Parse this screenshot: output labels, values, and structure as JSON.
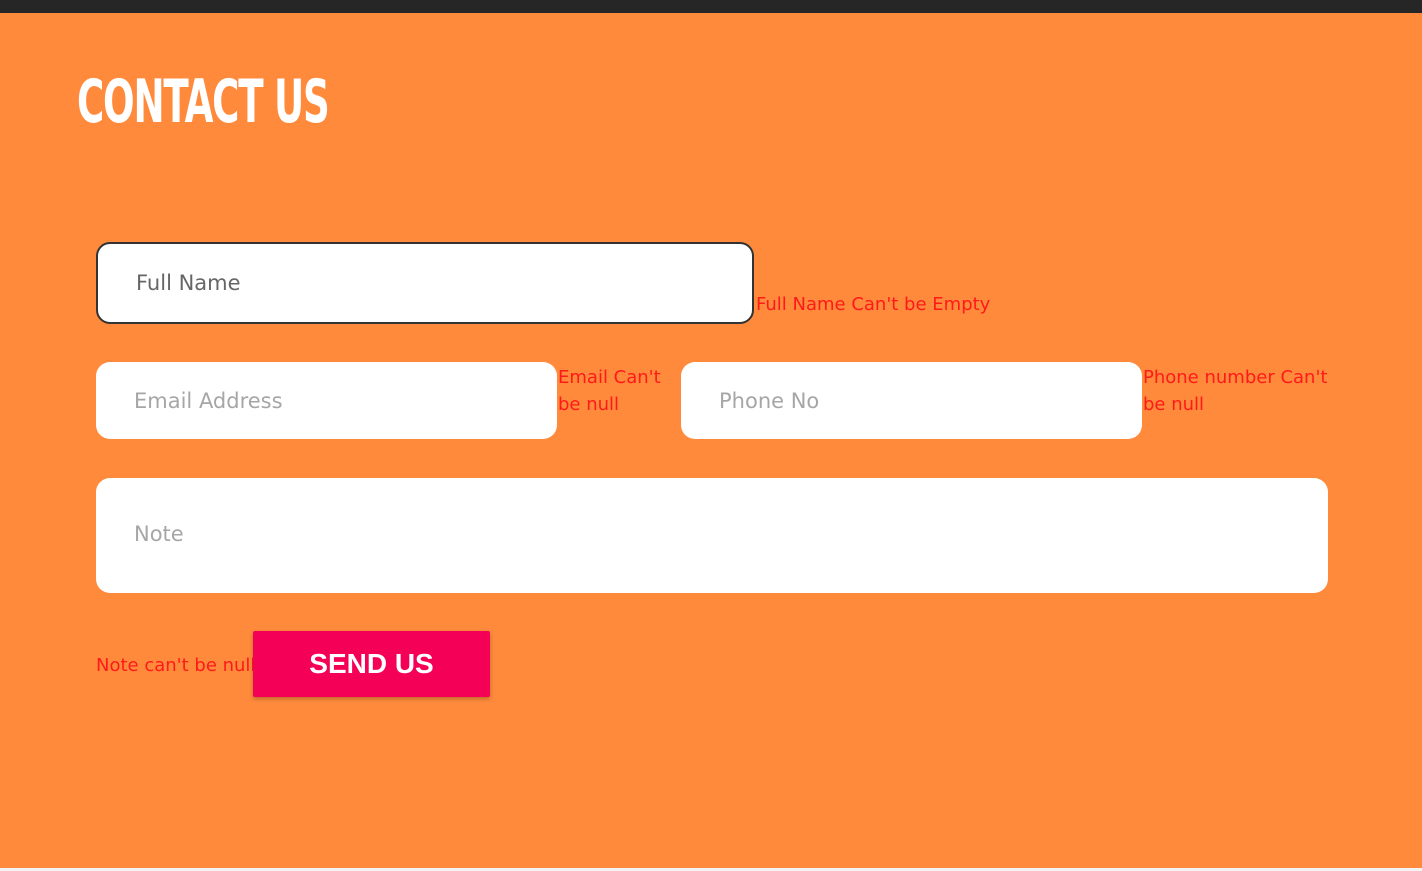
{
  "page": {
    "title": "Contact Us"
  },
  "form": {
    "full_name": {
      "placeholder": "Full Name",
      "error": "Full Name Can't be Empty"
    },
    "email": {
      "placeholder": "Email Address",
      "error": "Email Can't be null"
    },
    "phone": {
      "placeholder": "Phone No",
      "error": "Phone number Can't be null"
    },
    "note": {
      "placeholder": "Note",
      "error": "Note can't be null"
    },
    "submit_label": "SEND US"
  },
  "colors": {
    "background": "#ff8a3c",
    "topbar": "#262626",
    "error_text": "#ff1a1a",
    "button": "#f50057",
    "field_bg": "#ffffff"
  }
}
